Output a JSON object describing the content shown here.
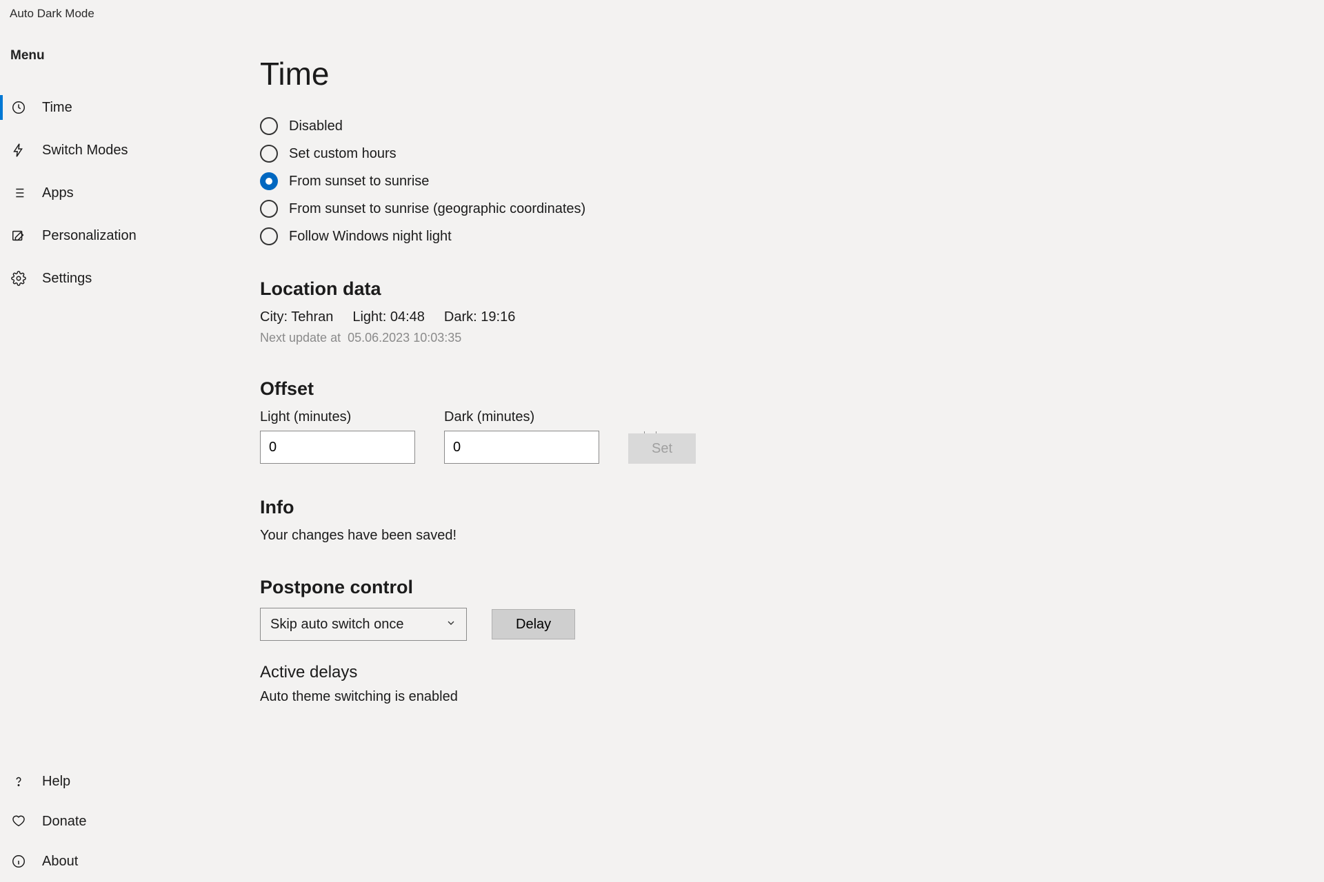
{
  "titlebar": {
    "app_name": "Auto Dark Mode"
  },
  "sidebar": {
    "menu_label": "Menu",
    "items": [
      {
        "label": "Time",
        "icon": "clock",
        "selected": true
      },
      {
        "label": "Switch Modes",
        "icon": "bolt",
        "selected": false
      },
      {
        "label": "Apps",
        "icon": "list",
        "selected": false
      },
      {
        "label": "Personalization",
        "icon": "pencil-square",
        "selected": false
      },
      {
        "label": "Settings",
        "icon": "gear",
        "selected": false
      }
    ],
    "bottom_items": [
      {
        "label": "Help",
        "icon": "question"
      },
      {
        "label": "Donate",
        "icon": "heart"
      },
      {
        "label": "About",
        "icon": "info"
      }
    ]
  },
  "main": {
    "title": "Time",
    "radios": [
      {
        "label": "Disabled",
        "selected": false
      },
      {
        "label": "Set custom hours",
        "selected": false
      },
      {
        "label": "From sunset to sunrise",
        "selected": true
      },
      {
        "label": "From sunset to sunrise (geographic coordinates)",
        "selected": false
      },
      {
        "label": "Follow Windows night light",
        "selected": false
      }
    ],
    "location": {
      "heading": "Location data",
      "city_label": "City:",
      "city_value": "Tehran",
      "light_label": "Light:",
      "light_value": "04:48",
      "dark_label": "Dark:",
      "dark_value": "19:16",
      "next_update_label": "Next update at",
      "next_update_value": "05.06.2023 10:03:35"
    },
    "offset": {
      "heading": "Offset",
      "light_label": "Light (minutes)",
      "light_value": "0",
      "dark_label": "Dark (minutes)",
      "dark_value": "0",
      "set_button": "Set"
    },
    "info": {
      "heading": "Info",
      "message": "Your changes have been saved!"
    },
    "postpone": {
      "heading": "Postpone control",
      "dropdown_value": "Skip auto switch once",
      "delay_button": "Delay",
      "active_heading": "Active delays",
      "active_text": "Auto theme switching is enabled"
    }
  }
}
